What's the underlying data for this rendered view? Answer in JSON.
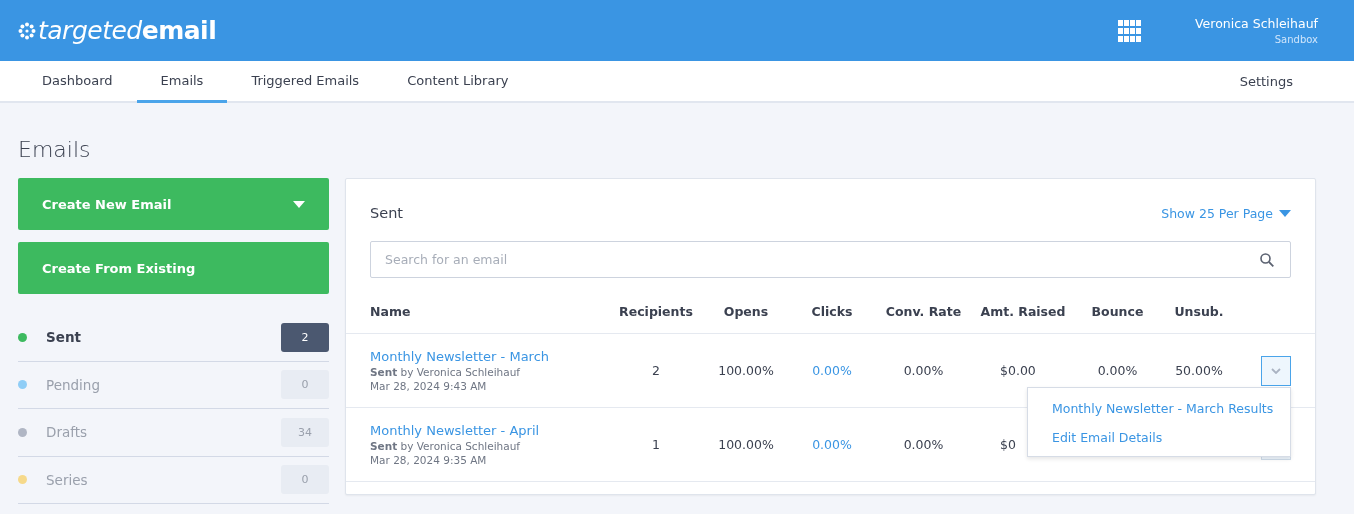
{
  "header": {
    "logo": {
      "light": "targeted",
      "bold": "email"
    },
    "user": {
      "name": "Veronica Schleihauf",
      "account": "Sandbox"
    }
  },
  "nav": {
    "tabs": [
      {
        "label": "Dashboard",
        "selected": false
      },
      {
        "label": "Emails",
        "selected": true
      },
      {
        "label": "Triggered Emails",
        "selected": false
      },
      {
        "label": "Content Library",
        "selected": false
      }
    ],
    "settings": "Settings"
  },
  "page_title": "Emails",
  "actions": [
    {
      "label": "Create New Email",
      "kind": "dropdown"
    },
    {
      "label": "Create From Existing",
      "kind": "plain"
    }
  ],
  "folders": [
    {
      "label": "Sent",
      "count": "2",
      "color": "#3dba5f",
      "selected": true
    },
    {
      "label": "Pending",
      "count": "0",
      "color": "#8fcdf6",
      "selected": false
    },
    {
      "label": "Drafts",
      "count": "34",
      "color": "#b0b6c4",
      "selected": false
    },
    {
      "label": "Series",
      "count": "0",
      "color": "#f6d98a",
      "selected": false
    }
  ],
  "panel": {
    "title": "Sent",
    "per_page": "Show 25 Per Page",
    "search": {
      "placeholder": "Search for an email"
    },
    "columns": [
      "Name",
      "Recipients",
      "Opens",
      "Clicks",
      "Conv. Rate",
      "Amt. Raised",
      "Bounce",
      "Unsub."
    ],
    "rows": [
      {
        "name": "Monthly Newsletter - March",
        "byline": "**Sent** by Veronica Schleihauf",
        "date": "Mar 28, 2024 9:43 AM",
        "recipients": "2",
        "opens": "100.00%",
        "clicks": "0.00%",
        "conv_rate": "0.00%",
        "amt_raised": "$0.00",
        "bounce": "0.00%",
        "unsub": "50.00%",
        "menu_open": true
      },
      {
        "name": "Monthly Newsletter - April",
        "byline": "**Sent** by Veronica Schleihauf",
        "date": "Mar 28, 2024 9:35 AM",
        "recipients": "1",
        "opens": "100.00%",
        "clicks": "0.00%",
        "conv_rate": "0.00%",
        "amt_raised": "$0",
        "menu_open": false
      }
    ],
    "menu": [
      "Monthly Newsletter - March Results",
      "Edit Email Details"
    ]
  }
}
